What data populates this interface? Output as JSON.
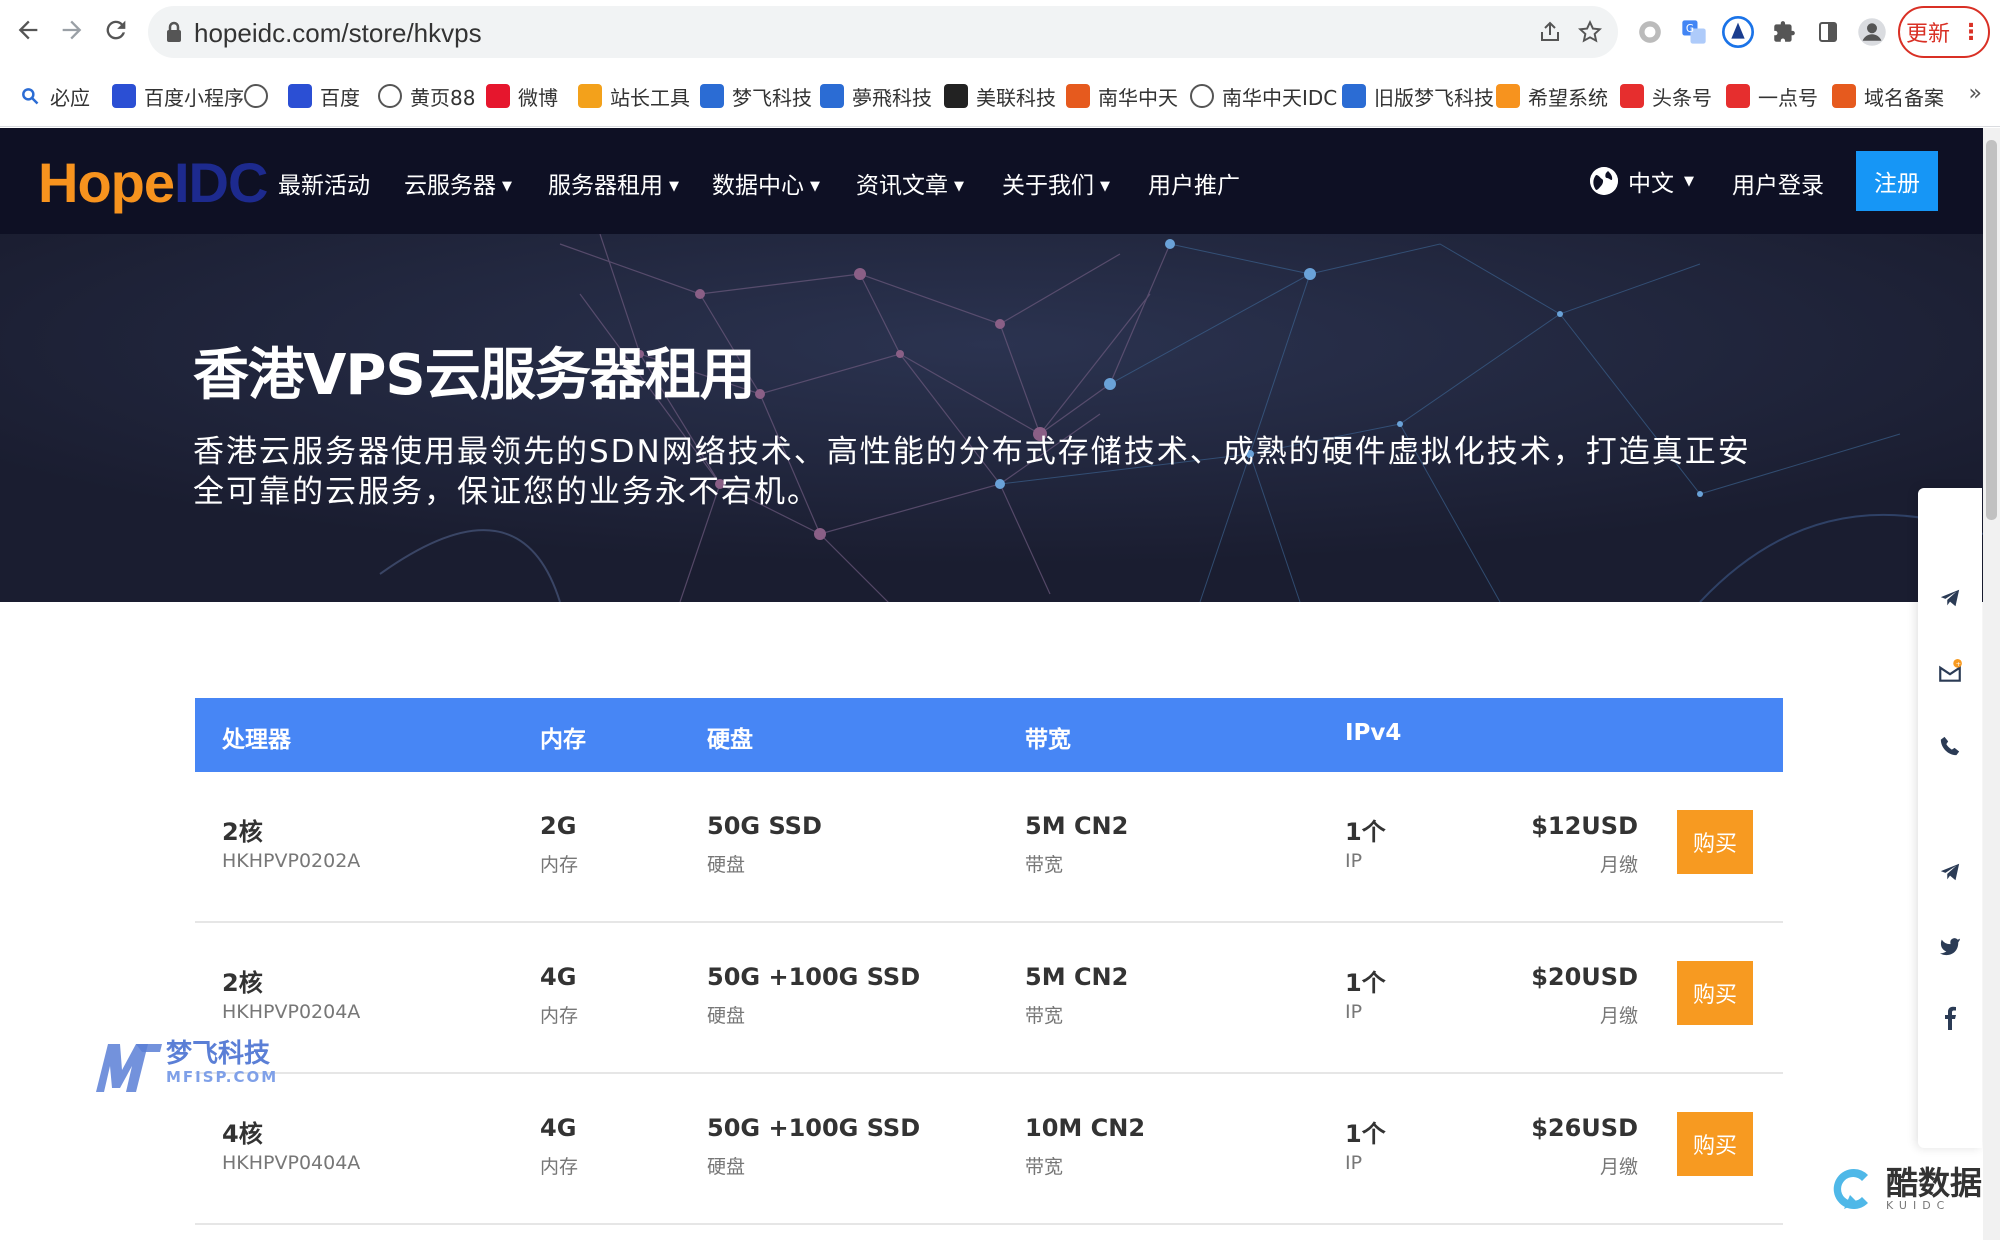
{
  "browser": {
    "url": "hopeidc.com/store/hkvps",
    "update_label": "更新",
    "bookmarks": [
      {
        "label": "必应",
        "icon": "search-icon",
        "color": "#2b6cd4"
      },
      {
        "label": "百度小程序",
        "icon": "baidu-paw-icon",
        "color": "#2b4fd4"
      },
      {
        "label": "",
        "icon": "globe-icon",
        "color": "#555555"
      },
      {
        "label": "百度",
        "icon": "baidu-paw-icon",
        "color": "#2b4fd4"
      },
      {
        "label": "黄页88",
        "icon": "globe-icon",
        "color": "#555555"
      },
      {
        "label": "微博",
        "icon": "weibo-icon",
        "color": "#e6162d"
      },
      {
        "label": "站长工具",
        "icon": "tools-icon",
        "color": "#f3a11b"
      },
      {
        "label": "梦飞科技",
        "icon": "mf-icon",
        "color": "#2b6cd4"
      },
      {
        "label": "夢飛科技",
        "icon": "mf-icon",
        "color": "#2b6cd4"
      },
      {
        "label": "美联科技",
        "icon": "ml-icon",
        "color": "#222222"
      },
      {
        "label": "南华中天",
        "icon": "nhzt-icon",
        "color": "#e65a1e"
      },
      {
        "label": "南华中天IDC",
        "icon": "globe-icon",
        "color": "#555555"
      },
      {
        "label": "旧版梦飞科技",
        "icon": "mf-icon",
        "color": "#2b6cd4"
      },
      {
        "label": "希望系统",
        "icon": "hope-icon",
        "color": "#f7931e"
      },
      {
        "label": "头条号",
        "icon": "toutiao-icon",
        "color": "#e62e2e"
      },
      {
        "label": "一点号",
        "icon": "yidian-icon",
        "color": "#e62e2e"
      },
      {
        "label": "域名备案",
        "icon": "beian-icon",
        "color": "#e65a1e"
      }
    ]
  },
  "header": {
    "logo_hope": "Hope",
    "logo_idc": "IDC",
    "menu": [
      {
        "label": "最新活动",
        "dropdown": false
      },
      {
        "label": "云服务器",
        "dropdown": true
      },
      {
        "label": "服务器租用",
        "dropdown": true
      },
      {
        "label": "数据中心",
        "dropdown": true
      },
      {
        "label": "资讯文章",
        "dropdown": true
      },
      {
        "label": "关于我们",
        "dropdown": true
      },
      {
        "label": "用户推广",
        "dropdown": false
      }
    ],
    "language": "中文",
    "login": "用户登录",
    "register": "注册"
  },
  "hero": {
    "title": "香港VPS云服务器租用",
    "description": "香港云服务器使用最领先的SDN网络技术、高性能的分布式存储技术、成熟的硬件虚拟化技术，打造真正安全可靠的云服务，保证您的业务永不宕机。"
  },
  "pricing": {
    "columns": [
      "处理器",
      "内存",
      "硬盘",
      "带宽",
      "IPv4"
    ],
    "buy_label": "购买",
    "plans": [
      {
        "cpu": "2核",
        "code": "HKHPVP0202A",
        "mem": "2G",
        "mem_sub": "内存",
        "disk": "50G SSD",
        "disk_sub": "硬盘",
        "bw": "5M CN2",
        "bw_sub": "带宽",
        "ip": "1个",
        "ip_sub": "IP",
        "price": "$12USD",
        "period": "月缴"
      },
      {
        "cpu": "2核",
        "code": "HKHPVP0204A",
        "mem": "4G",
        "mem_sub": "内存",
        "disk": "50G +100G SSD",
        "disk_sub": "硬盘",
        "bw": "5M CN2",
        "bw_sub": "带宽",
        "ip": "1个",
        "ip_sub": "IP",
        "price": "$20USD",
        "period": "月缴"
      },
      {
        "cpu": "4核",
        "code": "HKHPVP0404A",
        "mem": "4G",
        "mem_sub": "内存",
        "disk": "50G +100G SSD",
        "disk_sub": "硬盘",
        "bw": "10M CN2",
        "bw_sub": "带宽",
        "ip": "1个",
        "ip_sub": "IP",
        "price": "$26USD",
        "period": "月缴"
      }
    ]
  },
  "watermarks": {
    "mf_title": "梦飞科技",
    "mf_sub": "MFISP.COM",
    "kd_title": "酷数据",
    "kd_sub": "KUIDC"
  },
  "colors": {
    "header_bg": "#0e1024",
    "accent_blue": "#1696f6",
    "table_header": "#4786f5",
    "buy_orange": "#f79a21",
    "logo_orange": "#f7931e"
  }
}
